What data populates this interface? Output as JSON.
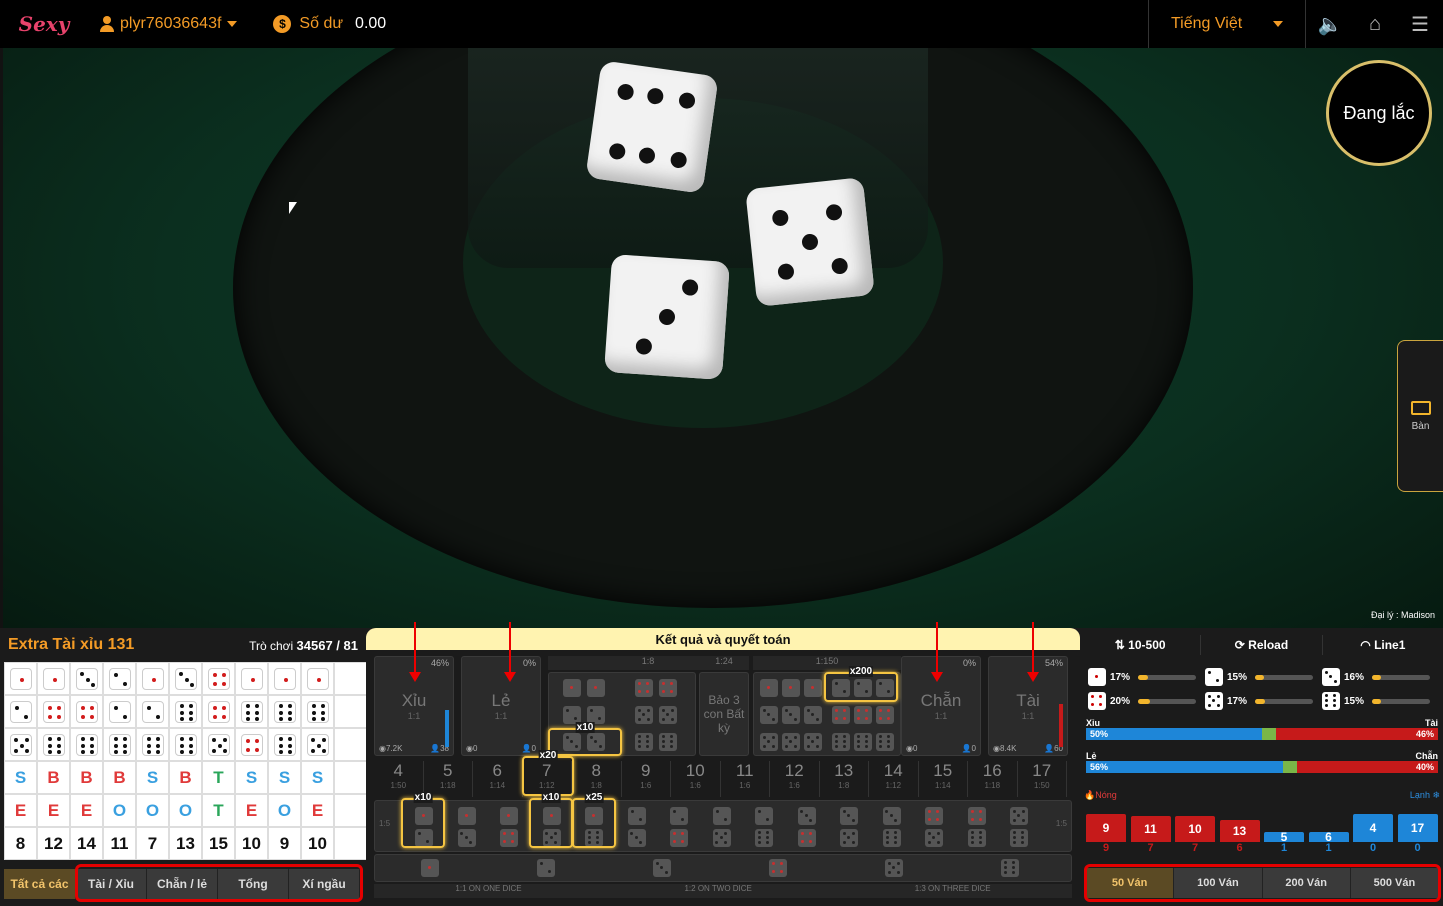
{
  "topbar": {
    "logo_text": "Sexy",
    "username": "plyr76036643f",
    "balance_label": "Số dư",
    "balance_value": "0.00",
    "language": "Tiếng Việt"
  },
  "video": {
    "status": "Đang lắc",
    "side_tab_label": "Bàn",
    "agent_label": "Đại lý : Madison"
  },
  "left_panel": {
    "title": "Extra Tài xỉu 131",
    "round_label": "Trò chơi",
    "round_value": "34567 / 81",
    "dice_rows": [
      [
        1,
        1,
        3,
        2,
        1,
        3,
        4,
        1,
        1,
        1
      ],
      [
        2,
        4,
        4,
        2,
        2,
        6,
        4,
        6,
        6,
        6
      ],
      [
        5,
        6,
        6,
        6,
        6,
        6,
        5,
        4,
        6,
        5
      ]
    ],
    "size_row": [
      "S",
      "B",
      "B",
      "B",
      "S",
      "B",
      "T",
      "S",
      "S",
      "S"
    ],
    "parity_row": [
      "E",
      "E",
      "E",
      "O",
      "O",
      "O",
      "T",
      "E",
      "O",
      "E"
    ],
    "sum_row": [
      "8",
      "12",
      "14",
      "11",
      "7",
      "13",
      "15",
      "10",
      "9",
      "10"
    ],
    "tabs": [
      "Tất cả các",
      "Tài / Xỉu",
      "Chẵn / lẻ",
      "Tổng",
      "Xí ngầu"
    ]
  },
  "board": {
    "banner": "Kết quả và quyết toán",
    "xiu": {
      "label": "Xỉu",
      "odds": "1:1",
      "pct": "46%",
      "amount": "7.2K",
      "players": "38"
    },
    "le": {
      "label": "Lẻ",
      "odds": "1:1",
      "pct": "0%",
      "amount": "0",
      "players": "0"
    },
    "chan": {
      "label": "Chẵn",
      "odds": "1:1",
      "pct": "0%",
      "amount": "0",
      "players": "0"
    },
    "tai": {
      "label": "Tài",
      "odds": "1:1",
      "pct": "54%",
      "amount": "8.4K",
      "players": "60"
    },
    "pair_odds": "1:8",
    "any_triple_odds": "1:24",
    "any_triple_label": "Bảo 3 con Bất kỳ",
    "triple_odds": "1:150",
    "multipliers": {
      "triple": "x200",
      "pair": "x10",
      "sum7": "x20",
      "combo1": "x10",
      "combo2": "x10",
      "combo3": "x25"
    },
    "sums": [
      {
        "n": "4",
        "o": "1:50"
      },
      {
        "n": "5",
        "o": "1:18"
      },
      {
        "n": "6",
        "o": "1:14"
      },
      {
        "n": "7",
        "o": "1:12"
      },
      {
        "n": "8",
        "o": "1:8"
      },
      {
        "n": "9",
        "o": "1:6"
      },
      {
        "n": "10",
        "o": "1:6"
      },
      {
        "n": "11",
        "o": "1:6"
      },
      {
        "n": "12",
        "o": "1:6"
      },
      {
        "n": "13",
        "o": "1:8"
      },
      {
        "n": "14",
        "o": "1:12"
      },
      {
        "n": "15",
        "o": "1:14"
      },
      {
        "n": "16",
        "o": "1:18"
      },
      {
        "n": "17",
        "o": "1:50"
      }
    ],
    "combo_odds": "1:5",
    "single_footer": [
      "1:1 ON ONE DICE",
      "1:2 ON TWO DICE",
      "1:3 ON THREE DICE"
    ]
  },
  "right_panel": {
    "bet_limit": "10-500",
    "reload": "Reload",
    "line": "Line1",
    "face_probs": [
      {
        "face": 1,
        "pct": "17%",
        "fill": 0.17
      },
      {
        "face": 2,
        "pct": "15%",
        "fill": 0.15
      },
      {
        "face": 3,
        "pct": "16%",
        "fill": 0.16
      },
      {
        "face": 4,
        "pct": "20%",
        "fill": 0.2
      },
      {
        "face": 5,
        "pct": "17%",
        "fill": 0.17
      },
      {
        "face": 6,
        "pct": "15%",
        "fill": 0.15
      }
    ],
    "xiu_tai": {
      "left": "Xỉu",
      "right": "Tài",
      "left_pct": "50%",
      "right_pct": "46%",
      "left_val": 0.5,
      "right_val": 0.46
    },
    "le_chan": {
      "left": "Lẻ",
      "right": "Chẵn",
      "left_pct": "56%",
      "right_pct": "40%",
      "left_val": 0.56,
      "right_val": 0.4
    },
    "hot_label": "Nóng",
    "cold_label": "Lạnh",
    "hot": [
      {
        "n": "9",
        "c": "9"
      },
      {
        "n": "11",
        "c": "7"
      },
      {
        "n": "10",
        "c": "7"
      },
      {
        "n": "13",
        "c": "6"
      }
    ],
    "cold": [
      {
        "n": "5",
        "c": "1"
      },
      {
        "n": "6",
        "c": "1"
      },
      {
        "n": "4",
        "c": "0"
      },
      {
        "n": "17",
        "c": "0"
      }
    ],
    "tabs": [
      "50 Ván",
      "100 Ván",
      "200 Ván",
      "500 Ván"
    ]
  },
  "colors": {
    "accent": "#f39b26",
    "gold": "#f5c542",
    "hot": "#c61a1a",
    "cold": "#1e86d8"
  }
}
